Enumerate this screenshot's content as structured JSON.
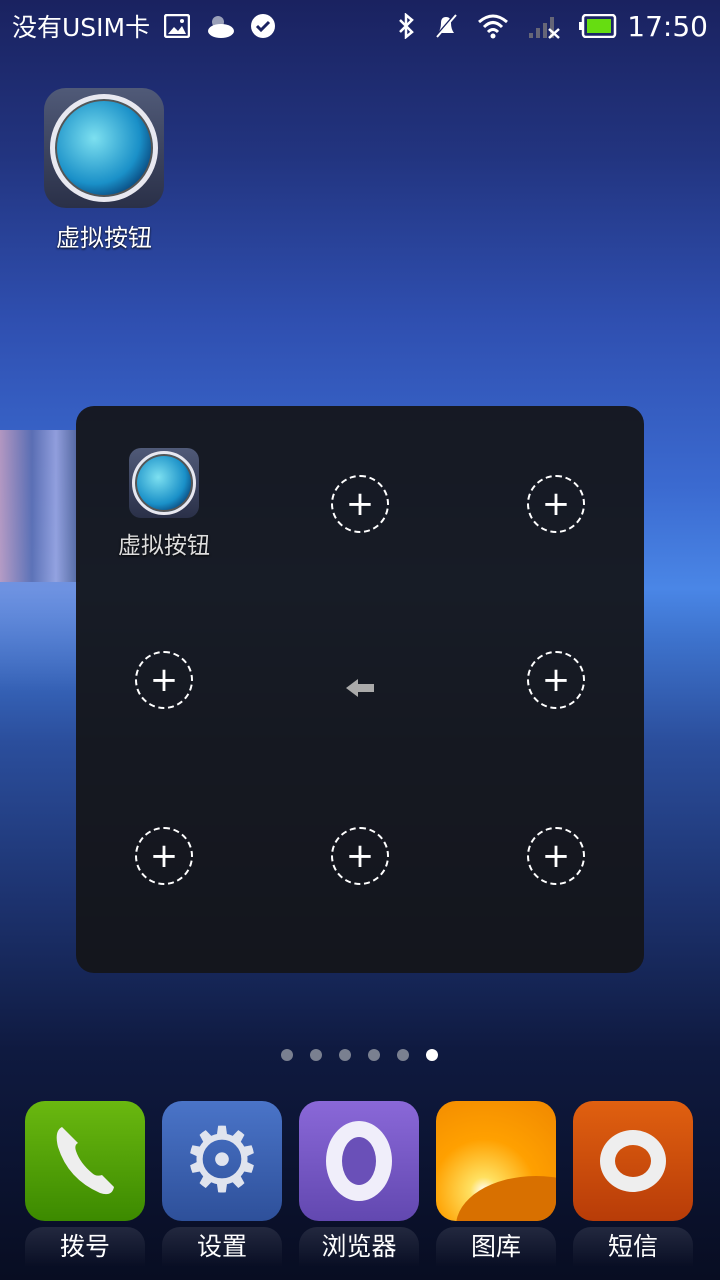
{
  "status_bar": {
    "carrier": "没有USIM卡",
    "time": "17:50",
    "icons": [
      "image-icon",
      "weather-cloudy-icon",
      "check-circle-icon",
      "bluetooth-icon",
      "notifications-muted-icon",
      "wifi-icon",
      "signal-none-icon",
      "battery-full-icon"
    ],
    "battery_color": "#66dd11"
  },
  "desktop": {
    "app": {
      "label": "虚拟按钮",
      "icon": "lens-icon"
    }
  },
  "folder": {
    "app": {
      "label": "虚拟按钮",
      "icon": "lens-icon"
    },
    "add_slot_symbol": "+",
    "back_icon": "arrow-left-icon"
  },
  "page_indicator": {
    "count": 6,
    "current": 6
  },
  "dock": [
    {
      "label": "拨号",
      "icon": "phone-icon",
      "color": "#4a9a0a"
    },
    {
      "label": "设置",
      "icon": "gear-icon",
      "color": "#3a62b0"
    },
    {
      "label": "浏览器",
      "icon": "browser-icon",
      "color": "#7a5cc8"
    },
    {
      "label": "图库",
      "icon": "gallery-icon",
      "color": "#f09000"
    },
    {
      "label": "短信",
      "icon": "message-icon",
      "color": "#d05010"
    }
  ]
}
